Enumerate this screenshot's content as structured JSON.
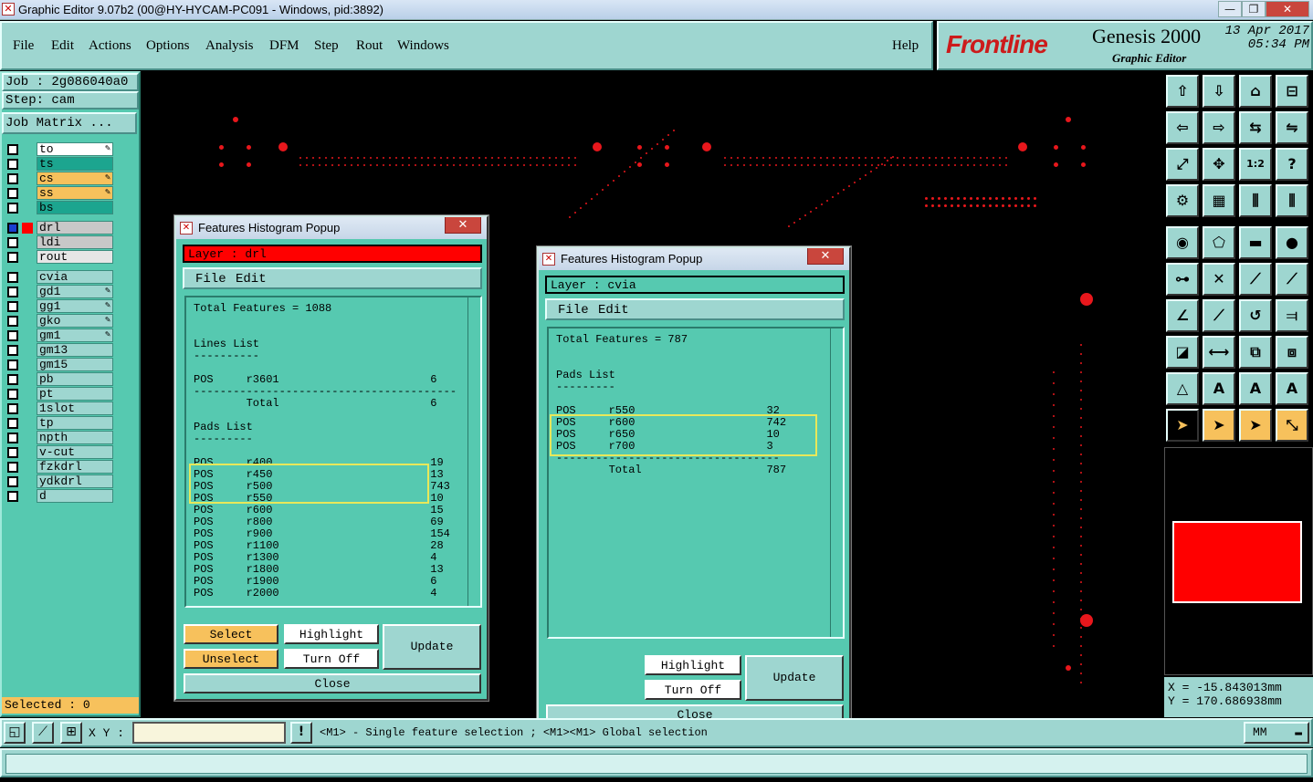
{
  "window": {
    "title": "Graphic Editor 9.07b2 (00@HY-HYCAM-PC091 - Windows, pid:3892)"
  },
  "menu": [
    "File",
    "Edit",
    "Actions",
    "Options",
    "Analysis",
    "DFM",
    "Step",
    "Rout",
    "Windows"
  ],
  "help": "Help",
  "brand": {
    "logo": "Frontline",
    "product": "Genesis 2000",
    "subtitle": "Graphic Editor",
    "date": "13 Apr 2017",
    "time": "05:34 PM"
  },
  "left": {
    "job": "Job : 2g086040a0",
    "step": "Step: cam",
    "job_matrix": "Job Matrix ...",
    "selected": "Selected : 0",
    "layers": [
      {
        "name": "to",
        "color": "#ffffff",
        "flag": true
      },
      {
        "name": "ts",
        "color": "#1ca58f",
        "flag": false
      },
      {
        "name": "cs",
        "color": "#f7c15c",
        "flag": true
      },
      {
        "name": "ss",
        "color": "#f7c15c",
        "flag": true
      },
      {
        "name": "bs",
        "color": "#1ca58f",
        "flag": false
      },
      {
        "name": "drl",
        "color": "#c8c8c8",
        "flag": false,
        "active": true
      },
      {
        "name": "ldi",
        "color": "#c8c8c8",
        "flag": false
      },
      {
        "name": "rout",
        "color": "#e6e6e6",
        "flag": false
      },
      {
        "name": "cvia",
        "color": "#9ed6d0",
        "flag": false
      },
      {
        "name": "gd1",
        "color": "#9ed6d0",
        "flag": true
      },
      {
        "name": "gg1",
        "color": "#9ed6d0",
        "flag": true
      },
      {
        "name": "gko",
        "color": "#9ed6d0",
        "flag": true
      },
      {
        "name": "gm1",
        "color": "#9ed6d0",
        "flag": true
      },
      {
        "name": "gm13",
        "color": "#9ed6d0",
        "flag": false
      },
      {
        "name": "gm15",
        "color": "#9ed6d0",
        "flag": false
      },
      {
        "name": "pb",
        "color": "#9ed6d0",
        "flag": false
      },
      {
        "name": "pt",
        "color": "#9ed6d0",
        "flag": false
      },
      {
        "name": "1slot",
        "color": "#9ed6d0",
        "flag": false
      },
      {
        "name": "tp",
        "color": "#9ed6d0",
        "flag": false
      },
      {
        "name": "npth",
        "color": "#9ed6d0",
        "flag": false
      },
      {
        "name": "v-cut",
        "color": "#9ed6d0",
        "flag": false
      },
      {
        "name": "fzkdrl",
        "color": "#9ed6d0",
        "flag": false
      },
      {
        "name": "ydkdrl",
        "color": "#9ed6d0",
        "flag": false
      },
      {
        "name": "d",
        "color": "#9ed6d0",
        "flag": false
      }
    ]
  },
  "dialog1": {
    "title": "Features Histogram Popup",
    "layer": "Layer :  drl",
    "menu_file": "File",
    "menu_edit": "Edit",
    "lines": [
      "Total Features = 1088",
      "",
      "",
      "Lines List",
      "----------",
      "",
      "POS     r3601                       6",
      "----------------------------------------",
      "        Total                       6",
      "",
      "Pads List",
      "---------",
      "",
      "POS     r400                        19",
      "POS     r450                        13",
      "POS     r500                        743",
      "POS     r550                        10",
      "POS     r600                        15",
      "POS     r800                        69",
      "POS     r900                        154",
      "POS     r1100                       28",
      "POS     r1300                       4",
      "POS     r1800                       13",
      "POS     r1900                       6",
      "POS     r2000                       4"
    ],
    "btn_select": "Select",
    "btn_unselect": "Unselect",
    "btn_highlight": "Highlight",
    "btn_turnoff": "Turn Off",
    "btn_update": "Update",
    "btn_close": "Close",
    "layer_color": "#ff0000"
  },
  "dialog2": {
    "title": "Features Histogram Popup",
    "layer": "Layer :  cvia",
    "menu_file": "File",
    "menu_edit": "Edit",
    "lines": [
      "Total Features = 787",
      "",
      "",
      "Pads List",
      "---------",
      "",
      "POS     r550                    32",
      "POS     r600                    742",
      "POS     r650                    10",
      "POS     r700                    3",
      "----------------------------------",
      "        Total                   787"
    ],
    "btn_highlight": "Highlight",
    "btn_turnoff": "Turn Off",
    "btn_update": "Update",
    "btn_close": "Close"
  },
  "coords": {
    "x": "X = -15.843013mm",
    "y": "Y = 170.686938mm"
  },
  "bottom": {
    "xy_label": "X Y :",
    "xy_value": "",
    "hint": "<M1> - Single feature selection ; <M1><M1> Global selection",
    "units": "MM"
  }
}
